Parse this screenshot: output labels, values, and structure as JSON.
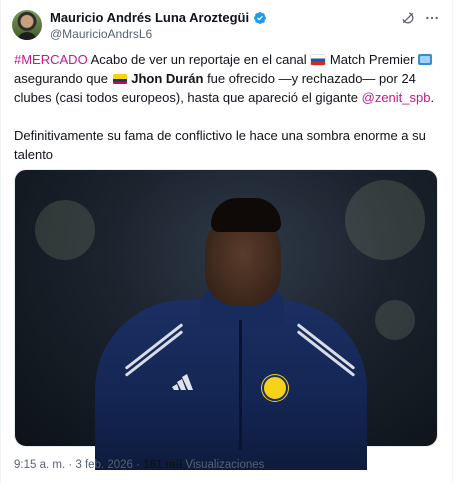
{
  "author": {
    "display_name": "Mauricio Andrés Luna Aroztegüi",
    "handle": "@MauricioAndrsL6",
    "verified": true
  },
  "tweet": {
    "hashtag": "#MERCADO",
    "seg1": " Acabo de ver un reportaje en el canal ",
    "seg2": " Match Premier ",
    "seg3": "asegurando que ",
    "player": "Jhon Durán",
    "seg4": " fue ofrecido —y rechazado— por 24 clubes (casi todos europeos), hasta que apareció el gigante ",
    "mention": "@zenit_spb",
    "seg5": ".",
    "paragraph2": "Definitivamente su fama de conflictivo le hace una sombra enorme a su talento"
  },
  "icons": {
    "verified": "verified-badge-icon",
    "grok": "grok-icon",
    "more": "more-icon",
    "flag_russia": "russia-flag-icon",
    "flag_colombia": "colombia-flag-icon",
    "tv": "tv-icon"
  },
  "footer": {
    "time": "9:15 a. m.",
    "sep": " · ",
    "date": "3 feb. 2026",
    "views_count": "161 mil",
    "views_label": " Visualizaciones"
  },
  "colors": {
    "link": "#c2198b",
    "verified": "#1d9bf0",
    "secondary_text": "#536471"
  }
}
